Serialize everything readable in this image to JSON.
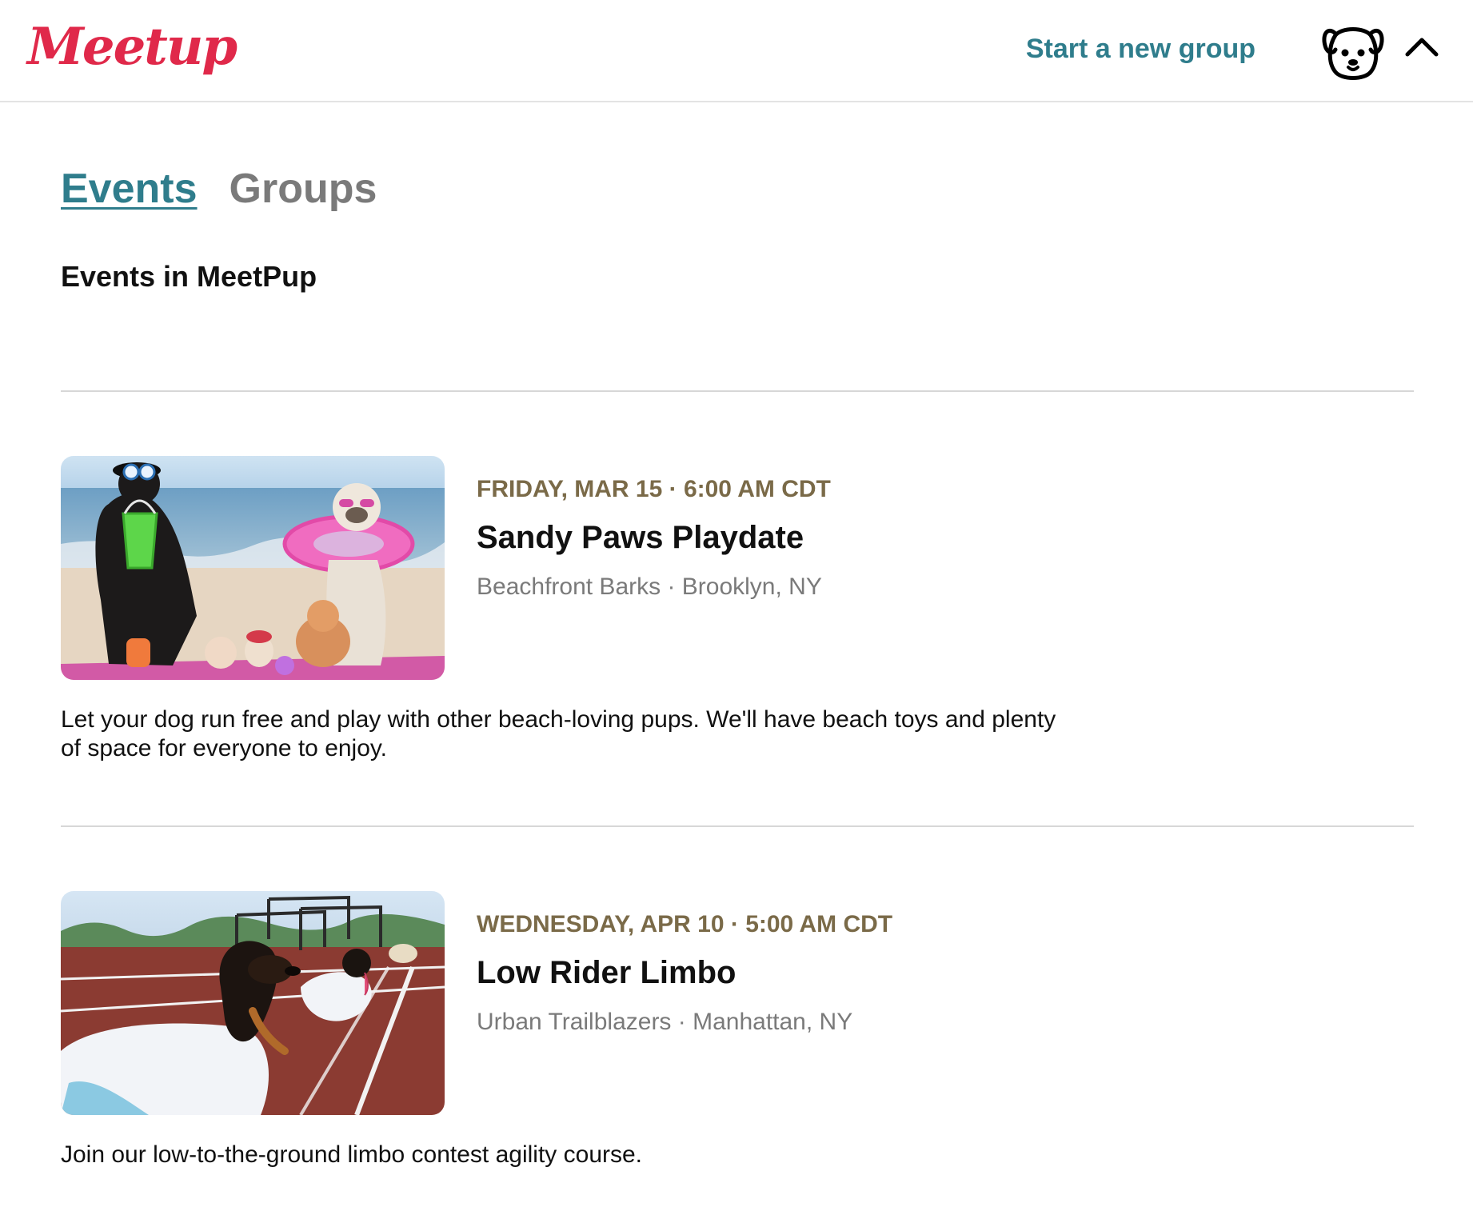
{
  "header": {
    "logo_text": "Meetup",
    "start_group_label": "Start a new group",
    "avatar_icon": "dog-face-icon",
    "menu_icon": "chevron-up-icon"
  },
  "tabs": {
    "events_label": "Events",
    "groups_label": "Groups"
  },
  "section_title": "Events in MeetPup",
  "events": [
    {
      "date": "FRIDAY, MAR 15 · 6:00 AM CDT",
      "title": "Sandy Paws Playdate",
      "group": "Beachfront Barks",
      "location": "Brooklyn, NY",
      "meta": "Beachfront Barks · Brooklyn, NY",
      "description": "Let your dog run free and play with other beach-loving pups. We'll have beach toys and plenty of space for everyone to enjoy.",
      "image": "beach-dogs-photo"
    },
    {
      "date": "WEDNESDAY, APR 10 · 5:00 AM CDT",
      "title": "Low Rider Limbo",
      "group": "Urban Trailblazers",
      "location": "Manhattan, NY",
      "meta": "Urban Trailblazers · Manhattan, NY",
      "description": "Join our low-to-the-ground limbo contest agility course.",
      "image": "dachshunds-on-track-photo"
    }
  ],
  "colors": {
    "brand": "#e0294a",
    "accent": "#2f7d8c",
    "date": "#7a6a48",
    "muted": "#7a7a7a"
  }
}
